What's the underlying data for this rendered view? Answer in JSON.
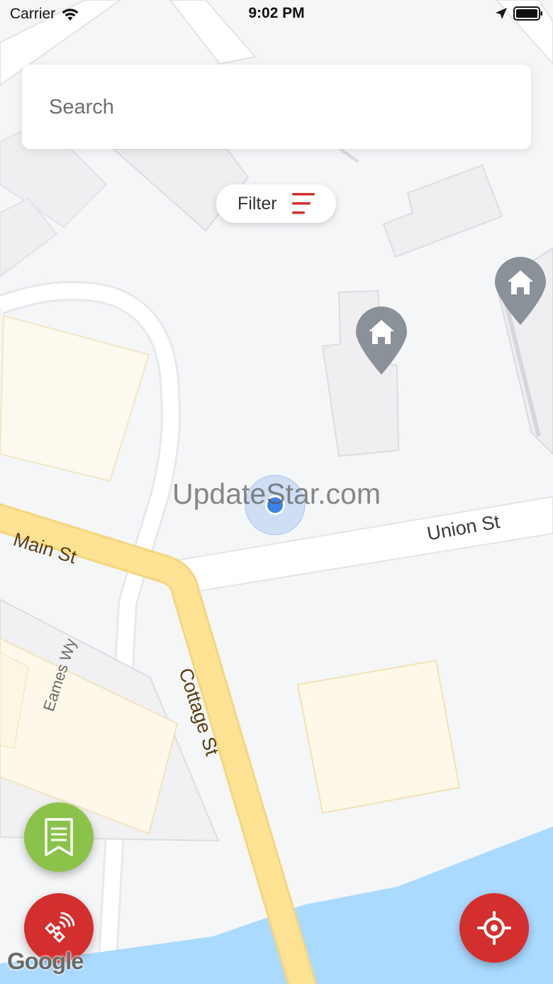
{
  "status_bar": {
    "carrier": "Carrier",
    "time": "9:02 PM"
  },
  "search": {
    "placeholder": "Search"
  },
  "filter": {
    "label": "Filter",
    "icon": "filter-lines-icon"
  },
  "map": {
    "streets": {
      "main": "Main St",
      "union": "Union St",
      "cottage": "Cottage St",
      "eames": "Eames Wy"
    },
    "pins": [
      {
        "type": "house",
        "icon": "home-icon"
      },
      {
        "type": "house",
        "icon": "home-icon"
      }
    ],
    "watermark": "UpdateStar.com",
    "attribution": "Google"
  },
  "buttons": {
    "saved_list": {
      "icon": "bookmark-list-icon"
    },
    "tracking": {
      "icon": "satellite-signal-icon"
    },
    "locate": {
      "icon": "crosshair-icon"
    }
  },
  "colors": {
    "accent_red": "#d32f2f",
    "accent_green": "#8bc34a",
    "road_major": "#fde293",
    "water": "#aadaff",
    "pin_gray": "#8a9198",
    "location_blue": "#3b82e6"
  }
}
